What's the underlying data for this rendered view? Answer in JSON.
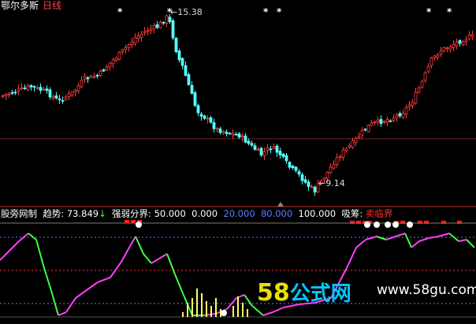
{
  "main_panel": {
    "stock_name": "鄂尔多斯",
    "period": "日线",
    "high_label": "15.38",
    "low_label": "9.14",
    "signal_marks": [
      "*",
      "*",
      "*",
      "*",
      "*",
      "*"
    ]
  },
  "indicator_panel": {
    "name": "股旁网制",
    "trend_label": "趋势:",
    "trend_value": "73.849",
    "trend_arrow": "↓",
    "boundary_label": "强弱分界:",
    "boundary_values": [
      "50.000",
      "0.000",
      "20.000",
      "80.000",
      "100.000"
    ],
    "absorb_label": "吸筹:",
    "sell_zone_label": "卖临界"
  },
  "watermark": {
    "brand_num": "58",
    "brand_text": "公式网",
    "url": "www.58gu.com"
  },
  "colors": {
    "up_candle": "#ff3b3b",
    "down_candle": "#54ffff",
    "trend_up": "#ff40ff",
    "trend_down": "#40ff40",
    "volume_bar": "#ffff66",
    "boundary_blue": "#5a7cff",
    "white": "#ffffff"
  }
}
